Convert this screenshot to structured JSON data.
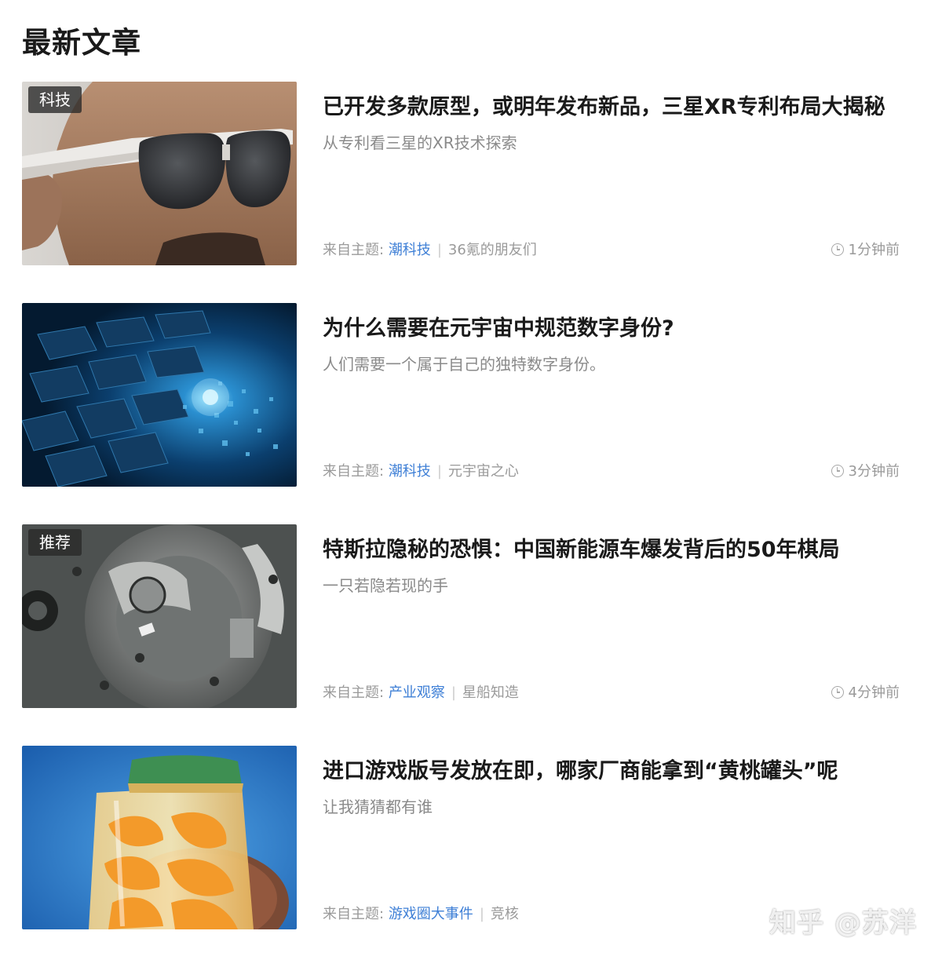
{
  "section": {
    "title": "最新文章"
  },
  "articles": [
    {
      "tag": "科技",
      "title": "已开发多款原型，或明年发布新品，三星XR专利布局大揭秘",
      "subtitle": "从专利看三星的XR技术探索",
      "meta_label": "来自主题:",
      "topic": "潮科技",
      "author": "36氪的朋友们",
      "time": "1分钟前",
      "image": "person-wearing-xr-glasses"
    },
    {
      "tag": "",
      "title": "为什么需要在元宇宙中规范数字身份?",
      "subtitle": "人们需要一个属于自己的独特数字身份。",
      "meta_label": "来自主题:",
      "topic": "潮科技",
      "author": "元宇宙之心",
      "time": "3分钟前",
      "image": "blue-digital-keyboard"
    },
    {
      "tag": "推荐",
      "title": "特斯拉隐秘的恐惧：中国新能源车爆发背后的50年棋局",
      "subtitle": "一只若隐若现的手",
      "meta_label": "来自主题:",
      "topic": "产业观察",
      "author": "星船知造",
      "time": "4分钟前",
      "image": "electric-motor-engine"
    },
    {
      "tag": "",
      "title": "进口游戏版号发放在即，哪家厂商能拿到“黄桃罐头”呢",
      "subtitle": "让我猜猜都有谁",
      "meta_label": "来自主题:",
      "topic": "游戏圈大事件",
      "author": "竞核",
      "time": "",
      "image": "jar-of-canned-peaches"
    }
  ],
  "watermark": "知乎 @苏洋",
  "colors": {
    "topic_link": "#3e7fd6",
    "muted_text": "#9a9a9a",
    "title_text": "#1a1a1a"
  },
  "icons": [
    "clock-icon"
  ]
}
